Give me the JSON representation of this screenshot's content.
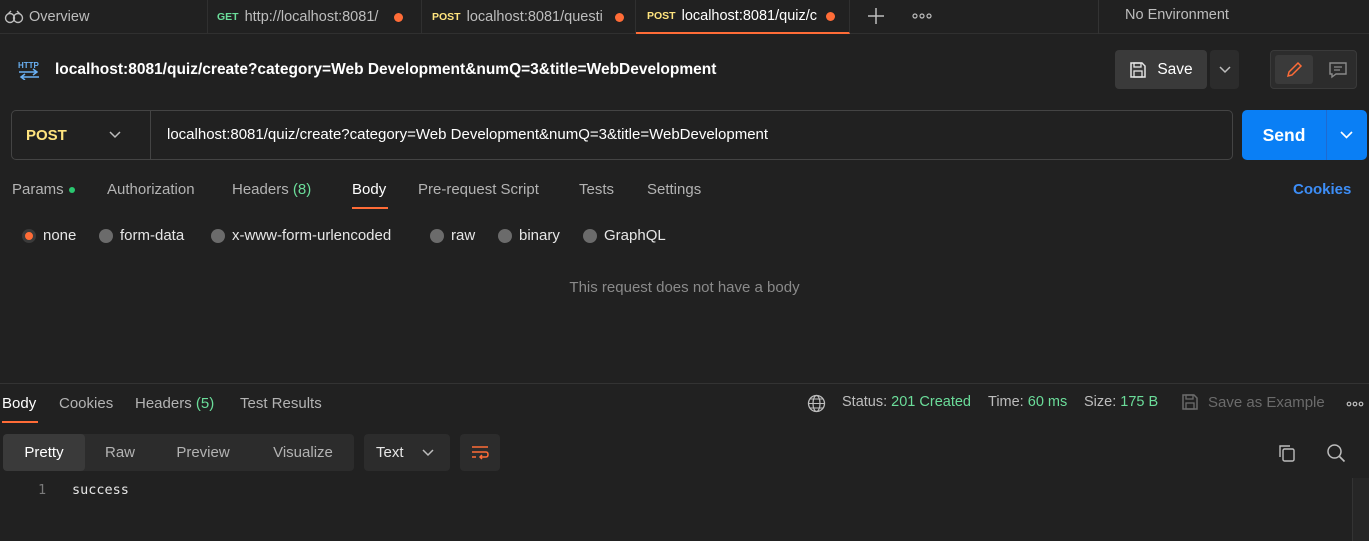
{
  "tabs": [
    {
      "label": "Overview",
      "method": ""
    },
    {
      "label": "http://localhost:8081/",
      "method": "GET"
    },
    {
      "label": "localhost:8081/questi",
      "method": "POST"
    },
    {
      "label": "localhost:8081/quiz/c",
      "method": "POST"
    }
  ],
  "environment": "No Environment",
  "request": {
    "title": "localhost:8081/quiz/create?category=Web Development&numQ=3&title=WebDevelopment",
    "method": "POST",
    "url": "localhost:8081/quiz/create?category=Web Development&numQ=3&title=WebDevelopment",
    "save_label": "Save",
    "send_label": "Send",
    "icon_label": "HTTP"
  },
  "request_tabs": {
    "params": "Params",
    "authorization": "Authorization",
    "headers": "Headers",
    "headers_count": "(8)",
    "body": "Body",
    "pre_request": "Pre-request Script",
    "tests": "Tests",
    "settings": "Settings",
    "cookies": "Cookies"
  },
  "body_types": [
    "none",
    "form-data",
    "x-www-form-urlencoded",
    "raw",
    "binary",
    "GraphQL"
  ],
  "selected_body_type": "none",
  "empty_body_message": "This request does not have a body",
  "response": {
    "tabs": {
      "body": "Body",
      "cookies": "Cookies",
      "headers": "Headers",
      "headers_count": "(5)",
      "test_results": "Test Results"
    },
    "status_label": "Status:",
    "status_value": "201 Created",
    "time_label": "Time:",
    "time_value": "60 ms",
    "size_label": "Size:",
    "size_value": "175 B",
    "save_example": "Save as Example",
    "views": [
      "Pretty",
      "Raw",
      "Preview",
      "Visualize"
    ],
    "format": "Text",
    "line_number": "1",
    "content": "success"
  },
  "colors": {
    "accent": "#ff6c37",
    "send": "#0a7ff5",
    "post": "#ffe47e",
    "get": "#6bdd9a",
    "success": "#6bdd9a",
    "link": "#3d8ef7"
  }
}
